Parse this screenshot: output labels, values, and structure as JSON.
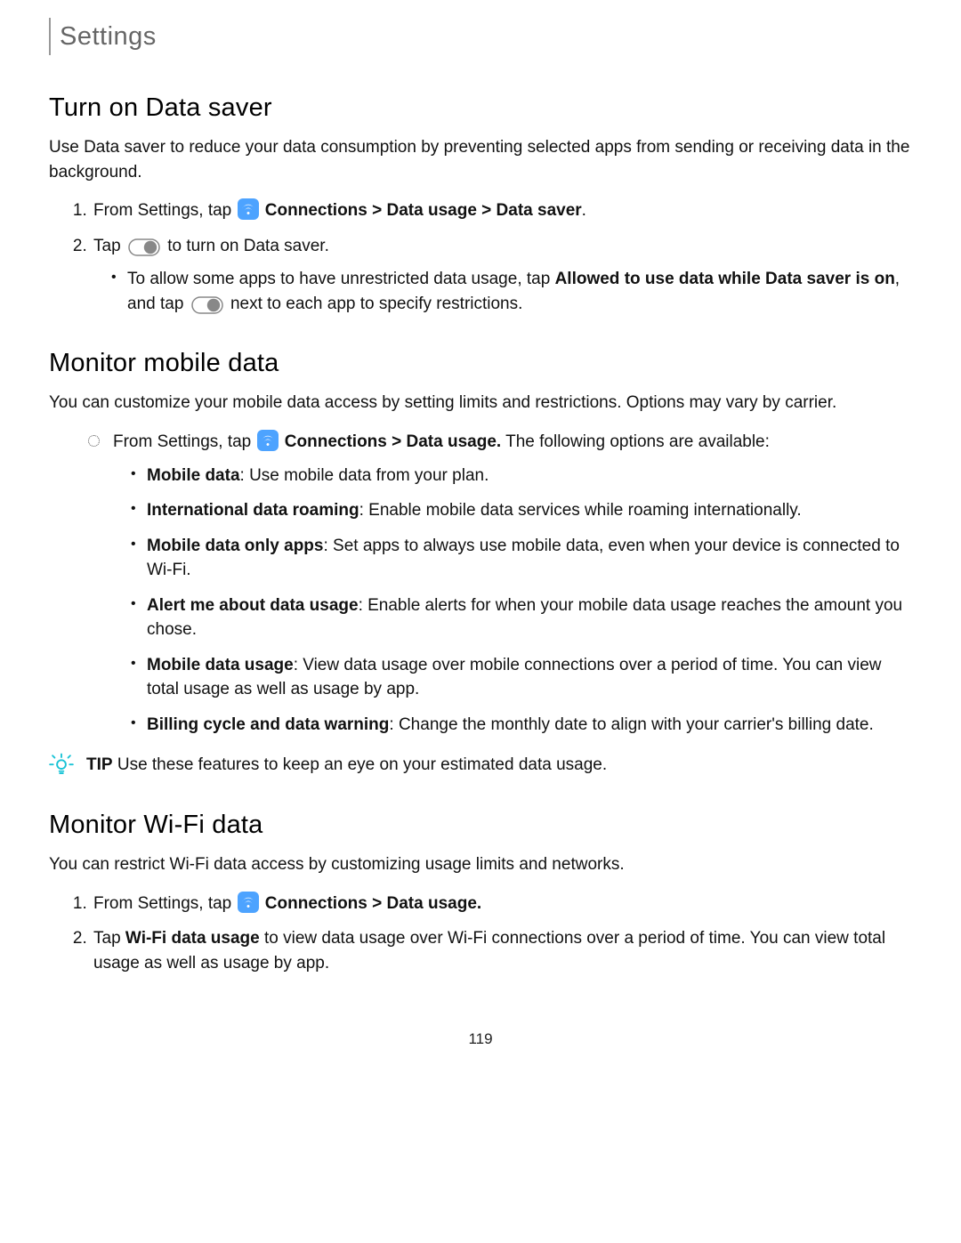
{
  "breadcrumb": "Settings",
  "pageNumber": "119",
  "s1": {
    "title": "Turn on Data saver",
    "intro": "Use Data saver to reduce your data consumption by preventing selected apps from sending or receiving data in the background.",
    "step1_pre": "From Settings, tap ",
    "step1_path": "Connections > Data usage > Data saver",
    "step1_post": ".",
    "step2_pre": "Tap ",
    "step2_post": " to turn on Data saver.",
    "sub_pre": "To allow some apps to have unrestricted data usage, tap ",
    "sub_bold1": "Allowed to use data while Data saver is on",
    "sub_mid": ", and tap ",
    "sub_post": " next to each app to specify restrictions."
  },
  "s2": {
    "title": "Monitor mobile data",
    "intro": "You can customize your mobile data access by setting limits and restrictions. Options may vary by carrier.",
    "lead_pre": "From Settings, tap ",
    "lead_path": "Connections > Data usage.",
    "lead_post": " The following options are available:",
    "opts": [
      {
        "bold": "Mobile data",
        "rest": ": Use mobile data from your plan."
      },
      {
        "bold": "International data roaming",
        "rest": ": Enable mobile data services while roaming internationally."
      },
      {
        "bold": "Mobile data only apps",
        "rest": ": Set apps to always use mobile data, even when your device is connected to Wi-Fi."
      },
      {
        "bold": "Alert me about data usage",
        "rest": ": Enable alerts for when your mobile data usage reaches the amount you chose."
      },
      {
        "bold": "Mobile data usage",
        "rest": ": View data usage over mobile connections over a period of time. You can view total usage as well as usage by app."
      },
      {
        "bold": "Billing cycle and data warning",
        "rest": ": Change the monthly date to align with your carrier's billing date."
      }
    ],
    "tip_label": "TIP",
    "tip_text": " Use these features to keep an eye on your estimated data usage."
  },
  "s3": {
    "title": "Monitor Wi-Fi data",
    "intro": "You can restrict Wi-Fi data access by customizing usage limits and networks.",
    "step1_pre": "From Settings, tap ",
    "step1_path": "Connections > Data usage.",
    "step2_pre": "Tap ",
    "step2_bold": "Wi-Fi data usage",
    "step2_post": " to view data usage over Wi-Fi connections over a period of time. You can view total usage as well as usage by app."
  }
}
